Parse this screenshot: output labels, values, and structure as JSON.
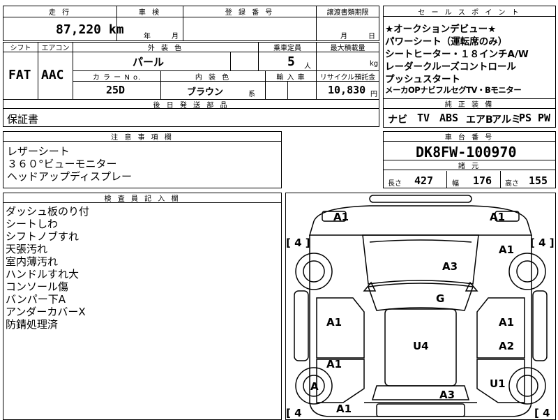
{
  "top_row": {
    "mileage_label": "走 行",
    "mileage_value": "87,220 km",
    "inspection_label": "車 検",
    "inspection_year": "年",
    "inspection_month": "月",
    "plate_label": "登 録 番 号",
    "transfer_label": "譲渡書類期限",
    "transfer_month": "月",
    "transfer_day": "日"
  },
  "row2": {
    "shift_label": "シフト",
    "aircon_label": "エアコン",
    "exterior_label": "外 装 色",
    "capacity_label": "乗車定員",
    "max_load_label": "最大積載量",
    "shift_value": "FAT",
    "aircon_value": "AAC",
    "exterior_value": "パール",
    "capacity_value": "5",
    "capacity_unit": "人",
    "load_unit": "kg",
    "color_no_label": "カ ラ ー N o.",
    "interior_label": "内 装 色",
    "import_label": "輸 入 車",
    "recycle_label": "リサイクル預託金",
    "color_no_value": "25D",
    "interior_value": "ブラウン",
    "interior_suffix": "系",
    "recycle_value": "10,830",
    "recycle_unit": "円"
  },
  "parts": {
    "label": "後 日 発 送 部 品",
    "value": "保証書"
  },
  "notes": {
    "label": "注 意 事 項 欄",
    "lines": [
      "レザーシート",
      "３６０°ビューモニター",
      "ヘッドアップディスプレー"
    ]
  },
  "inspector": {
    "label": "検 査 員 記 入 欄",
    "lines": [
      "ダッシュ板のり付",
      "シートしわ",
      "シフトノブすれ",
      "天張汚れ",
      "室内薄汚れ",
      "ハンドルすれ大",
      "コンソール傷",
      "バンパー下A",
      "アンダーカバーX",
      "防錆処理済"
    ]
  },
  "sales": {
    "label": "セ ー ル ス ポ イ ン ト",
    "lines": [
      "★オークションデビュー★",
      "パワーシート（運転席のみ）",
      "シートヒーター・１８インチA/W",
      "レーダークルーズコントロール",
      "プッシュスタート",
      "メーカOPナビフルセグTV・Bモニター"
    ]
  },
  "equipment": {
    "label": "純 正 装 備",
    "items": [
      "ナビ",
      "TV",
      "ABS",
      "エアB",
      "アルミ",
      "PS",
      "PW"
    ]
  },
  "chassis": {
    "label": "車 台 番 号",
    "value": "DK8FW-100970"
  },
  "specs": {
    "label": "諸 元",
    "length_label": "長さ",
    "length_value": "427",
    "width_label": "幅",
    "width_value": "176",
    "height_label": "高さ",
    "height_value": "155"
  },
  "diagram": {
    "tire_left_top": "[ 4 ]",
    "tire_right_top": "[ 4 ]",
    "tire_left_bottom": "[ 4",
    "tire_right_bottom": "[ 4",
    "marks": {
      "front_left": "A1",
      "front_right": "A1",
      "right_fender": "A1",
      "hood": "A3",
      "windshield": "G",
      "left_front_door": "A1",
      "right_front_door": "A1",
      "roof": "U4",
      "right_rear_door": "A2",
      "left_rear_door": "A1",
      "right_rear_fender": "U1",
      "left_rear_wheel": "A",
      "rear_hatch": "A3",
      "rear_left": "A1"
    }
  }
}
